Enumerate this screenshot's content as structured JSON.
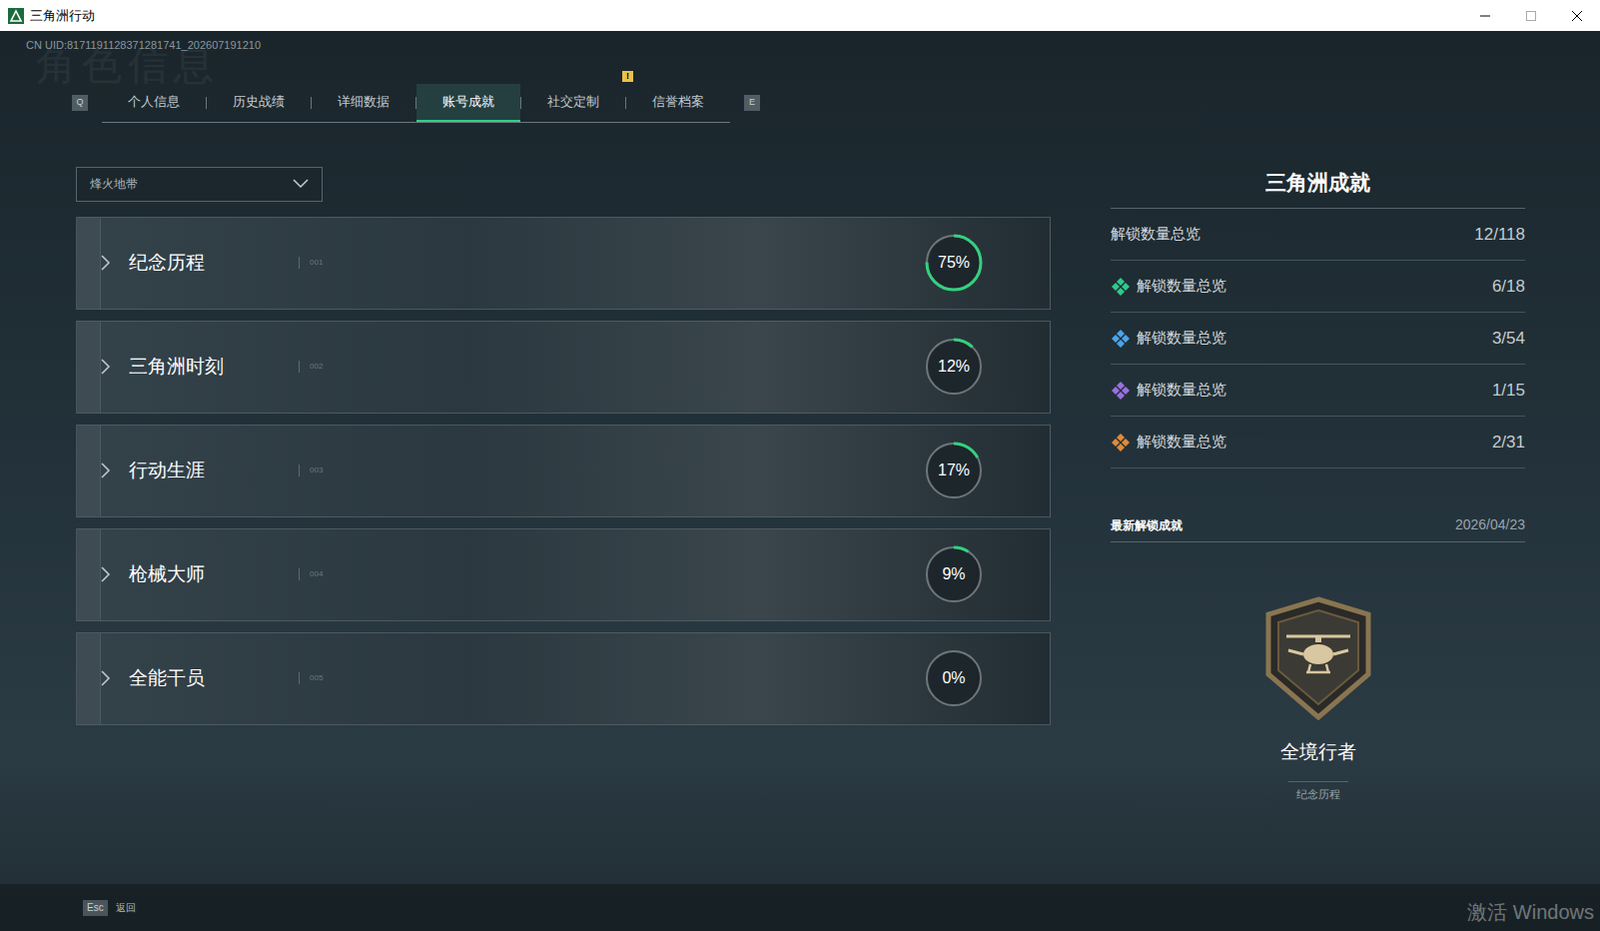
{
  "window": {
    "title": "三角洲行动"
  },
  "uid": "CN UID:8171191128371281741_202607191210",
  "watermark": "角色信息",
  "tabs": {
    "prev_key": "Q",
    "next_key": "E",
    "alert_badge": "!",
    "items": [
      {
        "label": "个人信息",
        "selected": false,
        "alert": false
      },
      {
        "label": "历史战绩",
        "selected": false,
        "alert": false
      },
      {
        "label": "详细数据",
        "selected": false,
        "alert": false
      },
      {
        "label": "账号成就",
        "selected": true,
        "alert": false
      },
      {
        "label": "社交定制",
        "selected": false,
        "alert": true
      },
      {
        "label": "信誉档案",
        "selected": false,
        "alert": false
      }
    ]
  },
  "mode_select": {
    "value": "烽火地带"
  },
  "categories": [
    {
      "index": "001",
      "name": "纪念历程",
      "percent": "75%",
      "level": 0.75
    },
    {
      "index": "002",
      "name": "三角洲时刻",
      "percent": "12%",
      "level": 0.12
    },
    {
      "index": "003",
      "name": "行动生涯",
      "percent": "17%",
      "level": 0.17
    },
    {
      "index": "004",
      "name": "枪械大师",
      "percent": "9%",
      "level": 0.09
    },
    {
      "index": "005",
      "name": "全能干员",
      "percent": "0%",
      "level": 0
    }
  ],
  "summary": {
    "title": "三角洲成就",
    "total": {
      "label": "解锁数量总览",
      "count": "12/118"
    },
    "tiers": [
      {
        "label": "解锁数量总览",
        "count": "6/18",
        "color": "#2fc98a"
      },
      {
        "label": "解锁数量总览",
        "count": "3/54",
        "color": "#4aa3e8"
      },
      {
        "label": "解锁数量总览",
        "count": "1/15",
        "color": "#9a6fe0"
      },
      {
        "label": "解锁数量总览",
        "count": "2/31",
        "color": "#e08a3a"
      }
    ]
  },
  "latest": {
    "label": "最新解锁成就",
    "date": "2026/04/23",
    "name": "全境行者",
    "category": "纪念历程"
  },
  "footer": {
    "key": "Esc",
    "label": "返回"
  },
  "os_watermark": "激活 Windows"
}
